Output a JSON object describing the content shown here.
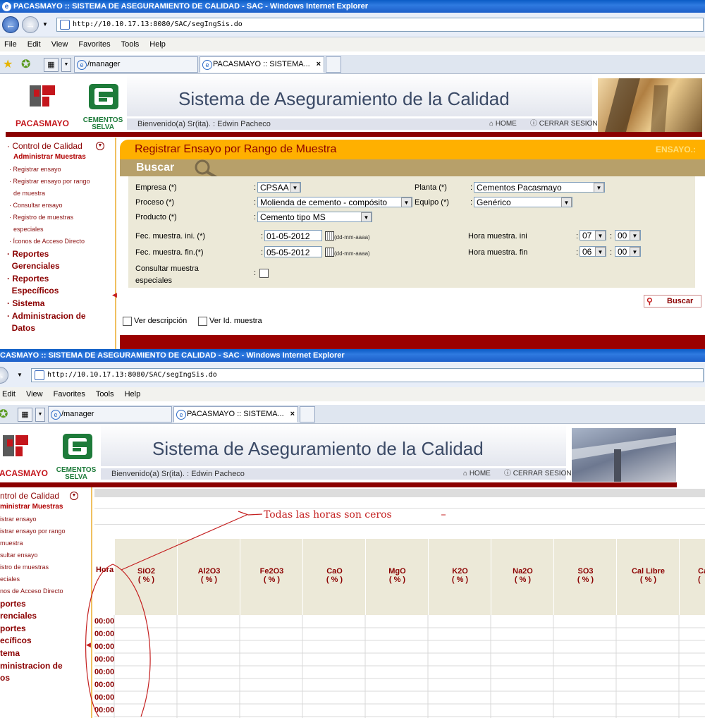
{
  "top": {
    "window_title": "PACASMAYO :: SISTEMA DE ASEGURAMIENTO DE CALIDAD - SAC - Windows Internet Explorer",
    "url": "http://10.10.17.13:8080/SAC/segIngSis.do",
    "menu": [
      "File",
      "Edit",
      "View",
      "Favorites",
      "Tools",
      "Help"
    ],
    "tabs": [
      "/manager",
      "PACASMAYO :: SISTEMA..."
    ],
    "tab_close": "×"
  },
  "bottom": {
    "window_title": "CASMAYO :: SISTEMA DE ASEGURAMIENTO DE CALIDAD - SAC - Windows Internet Explorer",
    "url": "http://10.10.17.13:8080/SAC/segIngSis.do",
    "menu": [
      "Edit",
      "View",
      "Favorites",
      "Tools",
      "Help"
    ],
    "tabs": [
      "/manager",
      "PACASMAYO :: SISTEMA..."
    ],
    "tab_close": "×"
  },
  "app": {
    "title": "Sistema de Aseguramiento de la Calidad",
    "brand1": "PACASMAYO",
    "brand1_cut": "ACASMAYO",
    "brand2_line1": "CEMENTOS",
    "brand2_line2": "SELVA",
    "welcome": "Bienvenido(a) Sr(ita). : Edwin Pacheco",
    "home": "HOME",
    "logout": "CERRAR SESION"
  },
  "sidebar": {
    "section": "Control de Calidad",
    "sub": "Administrar Muestras",
    "links": [
      "Registrar ensayo",
      "Registrar ensayo por rango",
      "de muestra",
      "Consultar ensayo",
      "Registro de muestras",
      "especiales",
      "Íconos de Acceso Directo"
    ],
    "groups": [
      "Reportes",
      "Gerenciales",
      "Reportes",
      "Específicos",
      "Sistema",
      "Administracion de",
      "Datos"
    ]
  },
  "sidebar_bottom": {
    "section": "ntrol de Calidad",
    "sub": "ministrar Muestras",
    "links": [
      "istrar ensayo",
      "istrar ensayo por rango",
      "muestra",
      "sultar ensayo",
      "istro de muestras",
      "eciales",
      "nos de Acceso Directo"
    ],
    "groups": [
      "portes",
      "renciales",
      "portes",
      "ecíficos",
      "tema",
      "ministracion de",
      "os"
    ]
  },
  "form": {
    "heading": "Registrar Ensayo por Rango de Muestra",
    "ensayo_label": "ENSAYO.:",
    "buscar_title": "Buscar",
    "colon": ":",
    "labels": {
      "empresa": "Empresa (*)",
      "proceso": "Proceso (*)",
      "producto": "Producto (*)",
      "planta": "Planta (*)",
      "equipo": "Equipo (*)",
      "fec_ini": "Fec. muestra. ini. (*)",
      "fec_fin": "Fec. muestra. fin.(*)",
      "hora_ini": "Hora muestra. ini",
      "hora_fin": "Hora muestra. fin",
      "consultar_1": "Consultar muestra",
      "consultar_2": "especiales"
    },
    "values": {
      "empresa": "CPSAA",
      "proceso": "Molienda de cemento - compósito",
      "producto": "Cemento tipo MS",
      "planta": "Cementos Pacasmayo",
      "equipo": "Genérico",
      "fec_ini": "01-05-2012",
      "fec_fin": "05-05-2012",
      "date_hint": "(dd-mm-aaaa)",
      "hora_ini_h": "07",
      "hora_ini_m": "00",
      "hora_fin_h": "06",
      "hora_fin_m": "00"
    },
    "buscar_button": "Buscar",
    "ver_descripcion": "Ver descripción",
    "ver_id_muestra": "Ver Id. muestra"
  },
  "table": {
    "annotation": "Todas las horas son ceros",
    "hora_header": "Hora",
    "columns": [
      "SiO2",
      "Al2O3",
      "Fe2O3",
      "CaO",
      "MgO",
      "K2O",
      "Na2O",
      "SO3",
      "Cal Libre",
      "Ca"
    ],
    "unit": "( % )",
    "unit_partial": "(",
    "rows": [
      "00:00",
      "00:00",
      "00:00",
      "00:00",
      "00:00",
      "00:00",
      "00:00",
      "00:00"
    ]
  }
}
